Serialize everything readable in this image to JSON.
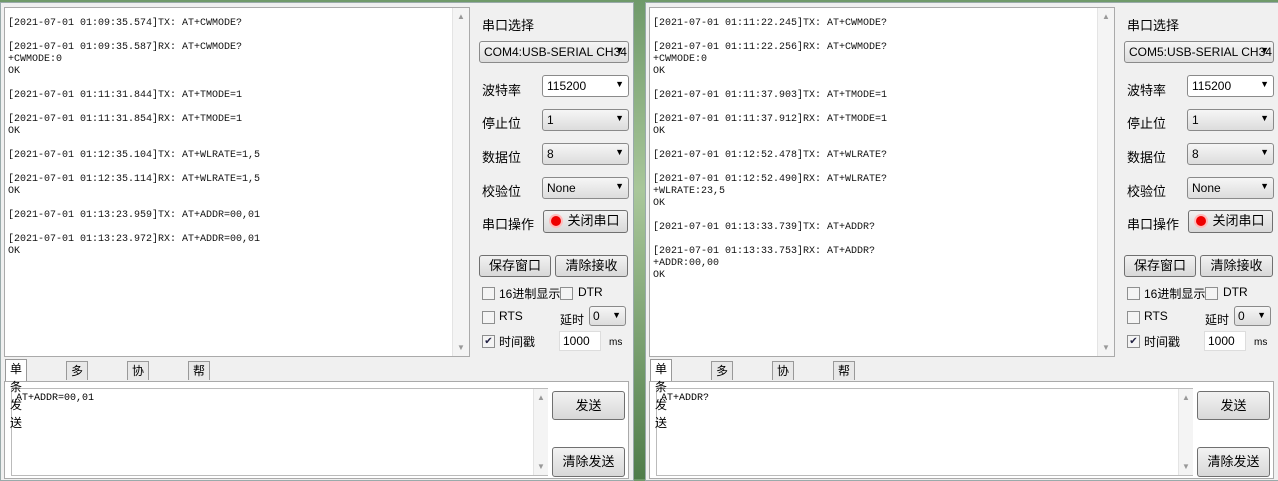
{
  "panels": [
    {
      "log": [
        "[2021-07-01 01:09:35.574]TX: AT+CWMODE?",
        "",
        "[2021-07-01 01:09:35.587]RX: AT+CWMODE?",
        "+CWMODE:0",
        "OK",
        "",
        "[2021-07-01 01:11:31.844]TX: AT+TMODE=1",
        "",
        "[2021-07-01 01:11:31.854]RX: AT+TMODE=1",
        "OK",
        "",
        "[2021-07-01 01:12:35.104]TX: AT+WLRATE=1,5",
        "",
        "[2021-07-01 01:12:35.114]RX: AT+WLRATE=1,5",
        "OK",
        "",
        "[2021-07-01 01:13:23.959]TX: AT+ADDR=00,01",
        "",
        "[2021-07-01 01:13:23.972]RX: AT+ADDR=00,01",
        "OK"
      ],
      "port": "COM4:USB-SERIAL CH34",
      "send_text": "AT+ADDR=00,01"
    },
    {
      "log": [
        "[2021-07-01 01:11:22.245]TX: AT+CWMODE?",
        "",
        "[2021-07-01 01:11:22.256]RX: AT+CWMODE?",
        "+CWMODE:0",
        "OK",
        "",
        "[2021-07-01 01:11:37.903]TX: AT+TMODE=1",
        "",
        "[2021-07-01 01:11:37.912]RX: AT+TMODE=1",
        "OK",
        "",
        "[2021-07-01 01:12:52.478]TX: AT+WLRATE?",
        "",
        "[2021-07-01 01:12:52.490]RX: AT+WLRATE?",
        "+WLRATE:23,5",
        "OK",
        "",
        "[2021-07-01 01:13:33.739]TX: AT+ADDR?",
        "",
        "[2021-07-01 01:13:33.753]RX: AT+ADDR?",
        "+ADDR:00,00",
        "OK"
      ],
      "port": "COM5:USB-SERIAL CH34",
      "send_text": "AT+ADDR?"
    }
  ],
  "labels": {
    "port_select": "串口选择",
    "baud": "波特率",
    "stop": "停止位",
    "data": "数据位",
    "parity": "校验位",
    "op": "串口操作",
    "close_port": "关闭串口",
    "save_window": "保存窗口",
    "clear_recv": "清除接收",
    "hex_display": "16进制显示",
    "dtr": "DTR",
    "rts": "RTS",
    "delay": "延时",
    "timestamp": "时间戳",
    "ms": "ms",
    "send": "发送",
    "clear_send": "清除发送"
  },
  "values": {
    "baud": "115200",
    "stop": "1",
    "data": "8",
    "parity": "None",
    "delay": "0",
    "interval": "1000"
  },
  "checks": {
    "hex_display": false,
    "dtr": false,
    "rts": false,
    "timestamp": true
  },
  "tabs": [
    "单条发送",
    "多条发送",
    "协议传输",
    "帮助"
  ]
}
